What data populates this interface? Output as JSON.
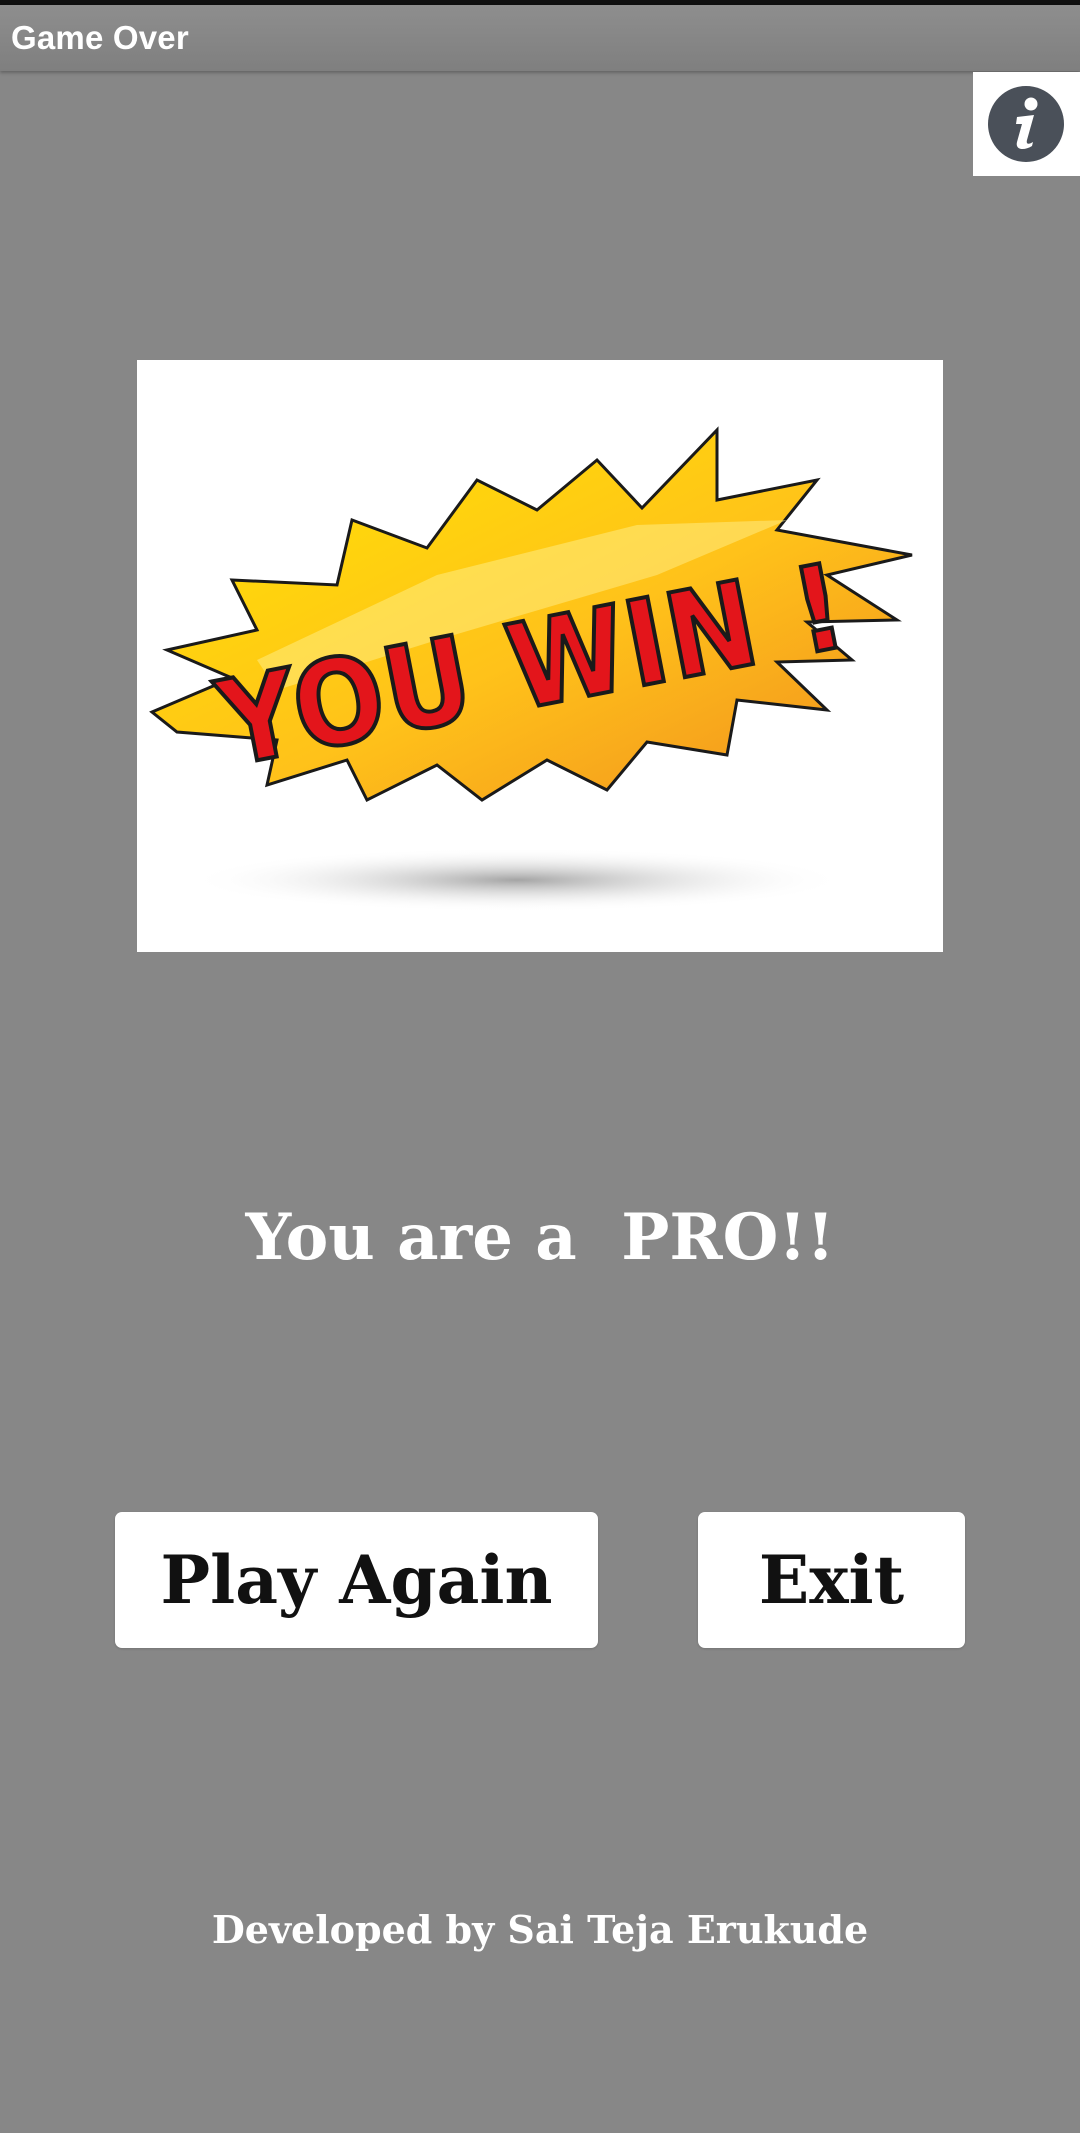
{
  "window": {
    "title": "Game Over"
  },
  "info_button": {
    "icon": "info-icon"
  },
  "banner": {
    "text": "YOU WIN !",
    "colors": {
      "burst_light": "#ffe000",
      "burst_dark": "#f29a1c",
      "letters": "#e3151b"
    }
  },
  "message": {
    "text": "You are a  PRO!!"
  },
  "buttons": {
    "play_again_label": "Play Again",
    "exit_label": "Exit"
  },
  "footer": {
    "credit": "Developed by Sai Teja Erukude"
  },
  "colors": {
    "background": "#878787",
    "button_bg": "#ffffff",
    "text_light": "#ffffff"
  }
}
